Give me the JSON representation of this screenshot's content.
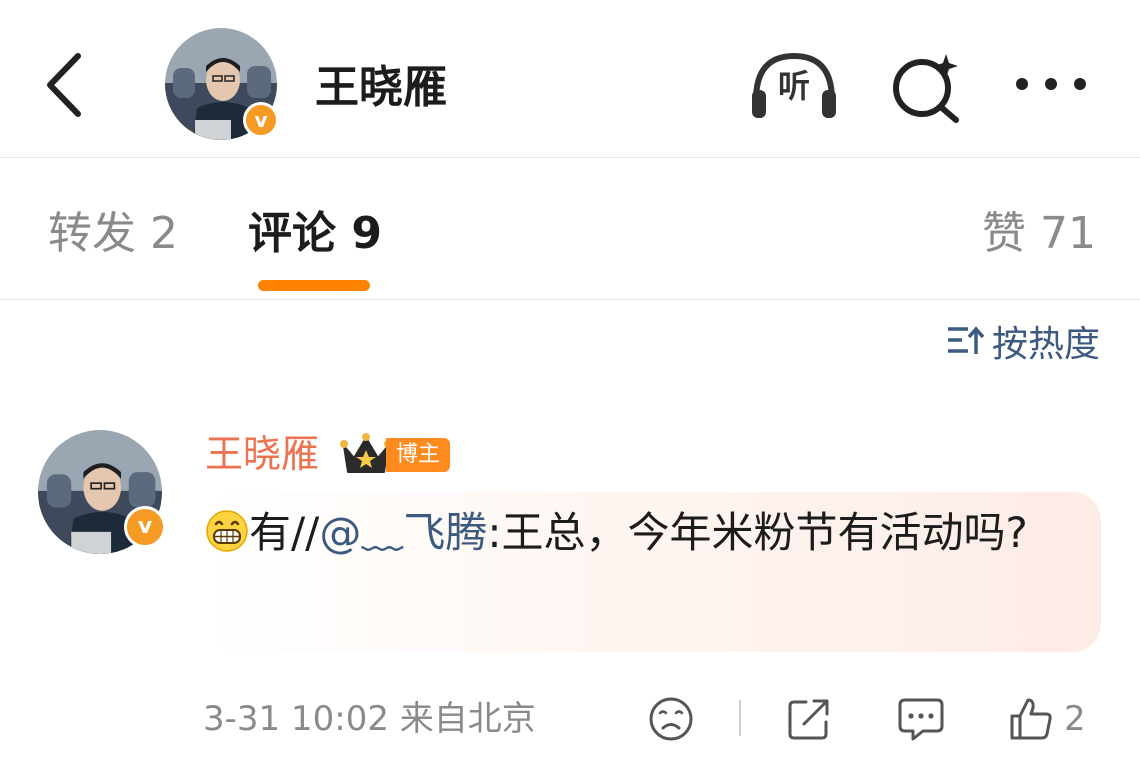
{
  "header": {
    "title": "王晓雁",
    "listen_label": "听",
    "verified_badge": "v"
  },
  "tabs": {
    "repost": "转发 2",
    "comment": "评论 9",
    "like": "赞 71",
    "active": "comment"
  },
  "sort": {
    "label": "按热度"
  },
  "comment": {
    "author": "王晓雁",
    "badge": "博主",
    "emoji": "grinning-emoji",
    "text_prefix": "有//",
    "mention": "@﹏飞腾",
    "text_suffix": ":王总，今年米粉节有活动吗?",
    "time": "3-31 10:02",
    "location": "来自北京",
    "like_count": "2",
    "verified_badge": "v"
  },
  "colors": {
    "accent": "#ff8200",
    "link": "#3c5a80",
    "author": "#eb7350",
    "verified": "#f59a23"
  }
}
